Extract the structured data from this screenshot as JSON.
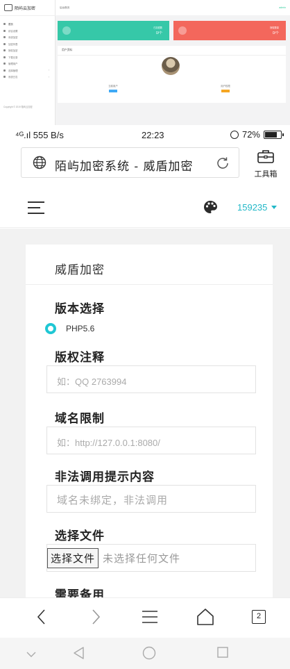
{
  "mini_admin": {
    "brand": "陌屿云加密",
    "topbar_label": "后台首页",
    "user": "admin",
    "nav": [
      "首页",
      "综合设置",
      "系统加密",
      "加密列表",
      "授权加密",
      "下载记录",
      "管理用户",
      "选择管理",
      "系统日志"
    ],
    "copyright": "Copyright © 2019 陌屿云加密",
    "card_left": {
      "label": "已加密数",
      "value": "0/个"
    },
    "card_right": {
      "label": "授权数量",
      "value": "0/个"
    },
    "panel_title": "用户资料",
    "stats": [
      {
        "label": "当前用户"
      },
      {
        "label": "用户权限"
      }
    ],
    "colors": {
      "teal": "#36c8a8",
      "red": "#f3675c"
    }
  },
  "status_bar": {
    "signal": "⁴ᴳ.ıl 555 B/s",
    "time": "22:23",
    "battery": "72%"
  },
  "browser": {
    "url_title": "陌屿加密系统 - 威盾加密",
    "toolbox_label": "工具箱",
    "tabs_count": "2"
  },
  "app_header": {
    "username": "159235",
    "accent": "#22b8c8"
  },
  "card": {
    "title": "威盾加密",
    "sections": {
      "version": {
        "label": "版本选择",
        "option": "PHP5.6"
      },
      "copyright": {
        "label": "版权注释",
        "placeholder": "如：QQ 2763994"
      },
      "domain": {
        "label": "域名限制",
        "placeholder": "如：http://127.0.0.1:8080/"
      },
      "illegal": {
        "label": "非法调用提示内容",
        "placeholder": "域名未绑定，非法调用"
      },
      "file": {
        "label": "选择文件",
        "button": "选择文件",
        "none": "未选择任何文件"
      },
      "record": {
        "label": "需要备用"
      }
    }
  },
  "icons": {
    "globe": "globe-icon",
    "reload": "reload-icon",
    "toolbox": "toolbox-icon",
    "menu": "hamburger-icon",
    "palette": "palette-icon",
    "back": "chevron-left-icon",
    "forward": "chevron-right-icon",
    "browser_menu": "menu-lines-icon",
    "home": "home-icon",
    "sys_back": "triangle-back-icon",
    "sys_home": "circle-home-icon",
    "sys_recent": "square-recent-icon",
    "sys_hide": "chevron-down-icon"
  }
}
